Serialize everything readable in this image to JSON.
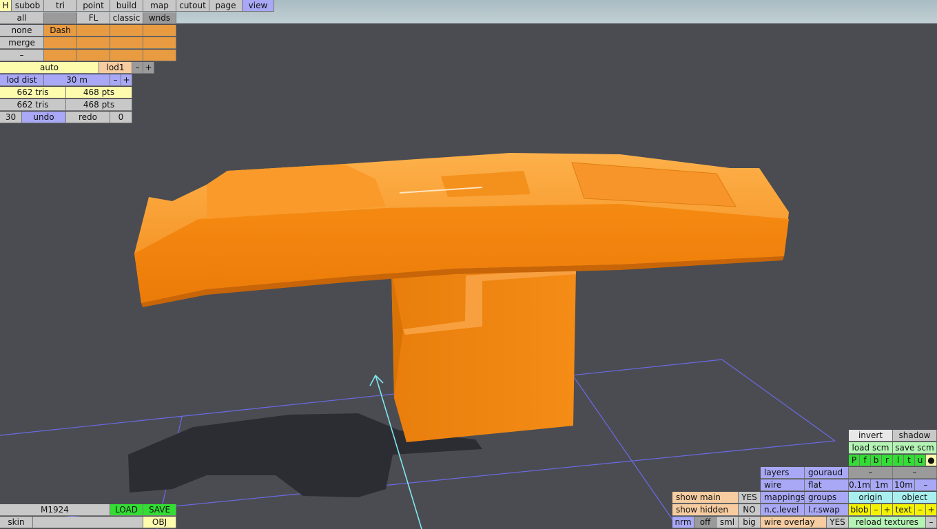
{
  "top_tabs": {
    "h": "H",
    "subob": "subob",
    "tri": "tri",
    "point": "point",
    "build": "build",
    "map": "map",
    "cutout": "cutout",
    "page": "page",
    "view": "view"
  },
  "left_panel": {
    "all": "all",
    "fl": "FL",
    "classic": "classic",
    "wnds": "wnds",
    "none": "none",
    "dash": "Dash",
    "merge": "merge",
    "dash_row": "–",
    "auto": "auto",
    "lod1": "lod1",
    "minus": "–",
    "plus": "+",
    "lod_dist": "lod dist",
    "lod_value": "30 m",
    "tris1": "662 tris",
    "pts1": "468 pts",
    "tris2": "662 tris",
    "pts2": "468 pts",
    "undo_count": "30",
    "undo": "undo",
    "redo": "redo",
    "redo_count": "0"
  },
  "bottom_left": {
    "model_name": "M1924",
    "load": "LOAD",
    "save": "SAVE",
    "skin": "skin",
    "obj": "OBJ"
  },
  "bottom_right": {
    "invert": "invert",
    "shadow": "shadow",
    "load_scm": "load scm",
    "save_scm": "save scm",
    "light_keys": [
      "P",
      "f",
      "b",
      "r",
      "l",
      "t",
      "u",
      "●"
    ],
    "layers": "layers",
    "gouraud": "gouraud",
    "dash_a": "–",
    "dash_b": "–",
    "wire": "wire",
    "flat": "flat",
    "m01": "0.1m",
    "m1": "1m",
    "m10": "10m",
    "dash_c": "–",
    "show_main": "show main",
    "show_main_val": "YES",
    "mappings": "mappings",
    "groups": "groups",
    "origin": "origin",
    "object": "object",
    "show_hidden": "show hidden",
    "show_hidden_val": "NO",
    "nc_level": "n.c.level",
    "lr_swap": "l.r.swap",
    "blob": "blob",
    "blob_minus": "–",
    "blob_plus": "+",
    "text": "text",
    "text_minus": "–",
    "text_plus": "+",
    "nrm": "nrm",
    "off": "off",
    "sml": "sml",
    "big": "big",
    "wire_overlay": "wire overlay",
    "wire_overlay_val": "YES",
    "reload_textures": "reload textures",
    "reload_minus": "–"
  },
  "colors": {
    "background": "#4b4c51",
    "model": "#f08a14",
    "grid": "#6a6ae6",
    "axis": "#7fe8f0"
  }
}
